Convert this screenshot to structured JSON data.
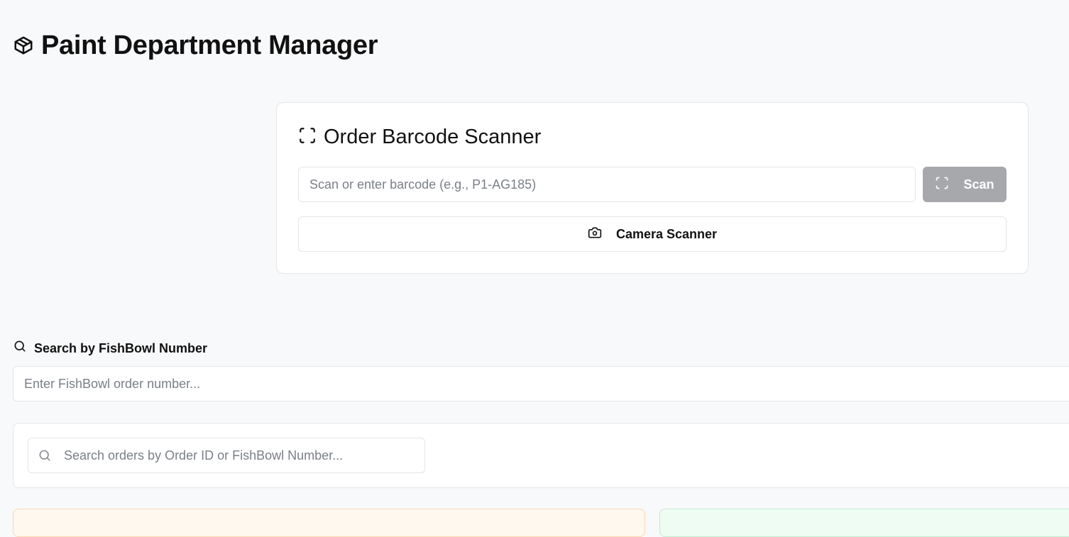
{
  "header": {
    "title": "Paint Department Manager",
    "icon": "package-icon"
  },
  "scanner": {
    "title": "Order Barcode Scanner",
    "title_icon": "scan-frame-icon",
    "input_placeholder": "Scan or enter barcode (e.g., P1-AG185)",
    "input_value": "",
    "scan_button_label": "Scan",
    "scan_button_icon": "scan-frame-icon",
    "camera_button_label": "Camera Scanner",
    "camera_button_icon": "camera-icon"
  },
  "fishbowl_search": {
    "label": "Search by FishBowl Number",
    "label_icon": "search-icon",
    "input_placeholder": "Enter FishBowl order number...",
    "input_value": ""
  },
  "orders_search": {
    "input_placeholder": "Search orders by Order ID or FishBowl Number...",
    "input_value": "",
    "icon": "search-icon"
  },
  "colors": {
    "page_background": "#f8f9fb",
    "scan_button_disabled": "#a6a8ab",
    "orange_card_background": "#fff8ee",
    "green_card_background": "#effcf3"
  }
}
